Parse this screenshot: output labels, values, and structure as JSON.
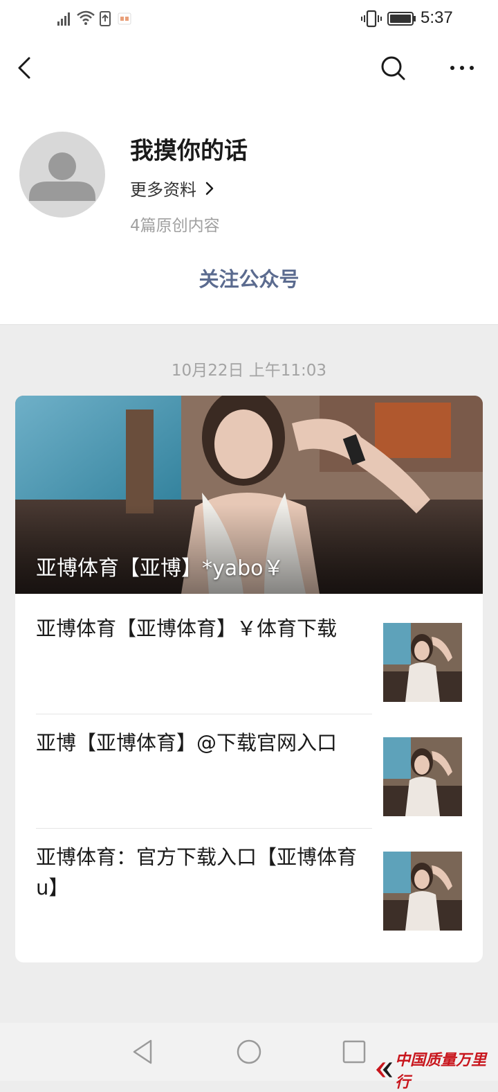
{
  "status_bar": {
    "time": "5:37",
    "icons": [
      "signal-icon",
      "wifi-icon",
      "upload-icon",
      "notification-icon",
      "vibrate-icon",
      "battery-icon"
    ]
  },
  "nav": {
    "icons": [
      "back-icon",
      "search-icon",
      "more-icon"
    ]
  },
  "profile": {
    "name": "我摸你的话",
    "more_info": "更多资料",
    "original_count": "4篇原创内容",
    "follow": "关注公众号"
  },
  "feed": {
    "date": "10月22日 上午11:03",
    "hero_title": "亚博体育【亚博】*yabo￥",
    "items": [
      {
        "title": "亚博体育【亚博体育】￥体育下载"
      },
      {
        "title": "亚博【亚博体育】@下载官网入口"
      },
      {
        "title": "亚博体育：官方下载入口【亚博体育u】"
      }
    ]
  },
  "system_nav": {
    "icons": [
      "nav-back-icon",
      "nav-home-icon",
      "nav-recent-icon"
    ]
  },
  "watermark": {
    "text": "中国质量万里行"
  },
  "colors": {
    "follow_text": "#5b6b8f",
    "background": "#ededed",
    "watermark": "#c8161d"
  }
}
